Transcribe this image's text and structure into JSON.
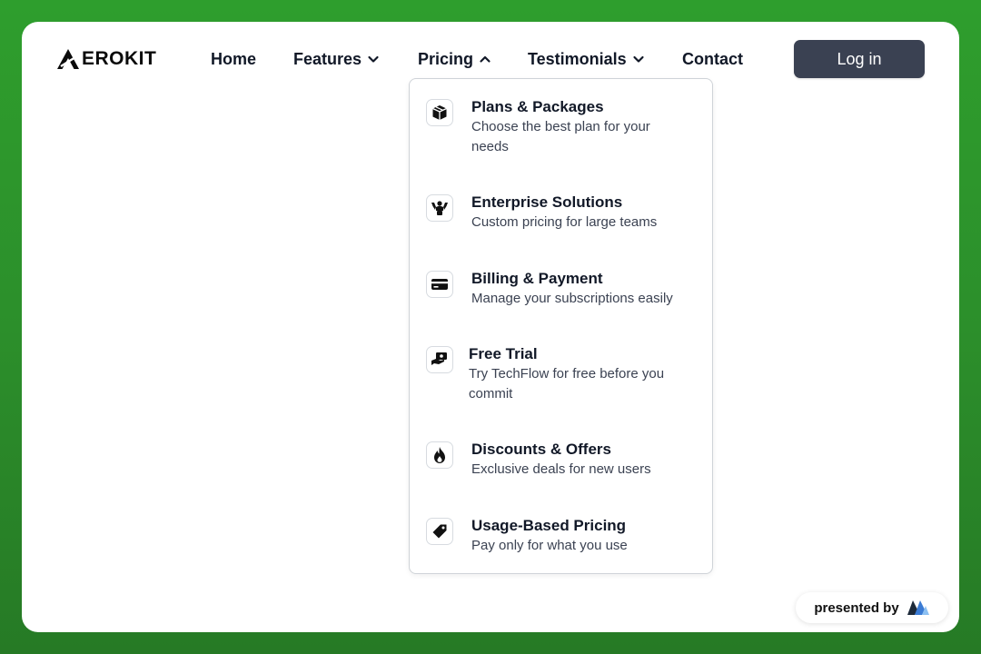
{
  "brand": {
    "logo_text": "EROKIT"
  },
  "nav": {
    "items": [
      {
        "label": "Home"
      },
      {
        "label": "Features"
      },
      {
        "label": "Pricing"
      },
      {
        "label": "Testimonials"
      },
      {
        "label": "Contact"
      }
    ],
    "login_label": "Log in"
  },
  "pricing_menu": {
    "items": [
      {
        "title": "Plans & Packages",
        "desc_lines": [
          "Choose the best plan for your",
          "needs"
        ],
        "icon": "package-icon"
      },
      {
        "title": "Enterprise Solutions",
        "desc_lines": [
          "Custom pricing for large teams"
        ],
        "icon": "team-icon"
      },
      {
        "title": "Billing & Payment",
        "desc_lines": [
          "Manage your subscriptions easily"
        ],
        "icon": "credit-card-icon"
      },
      {
        "title": "Free Trial",
        "desc_lines": [
          "Try TechFlow for free before you",
          "commit"
        ],
        "icon": "hand-coin-icon"
      },
      {
        "title": "Discounts & Offers",
        "desc_lines": [
          "Exclusive deals for new users"
        ],
        "icon": "flame-icon"
      },
      {
        "title": "Usage-Based Pricing",
        "desc_lines": [
          "Pay only for what you use"
        ],
        "icon": "price-tag-icon"
      }
    ]
  },
  "badge": {
    "label": "presented by"
  },
  "colors": {
    "background": "#2e9e2d",
    "login_button": "#3a4152",
    "text": "#111827"
  }
}
